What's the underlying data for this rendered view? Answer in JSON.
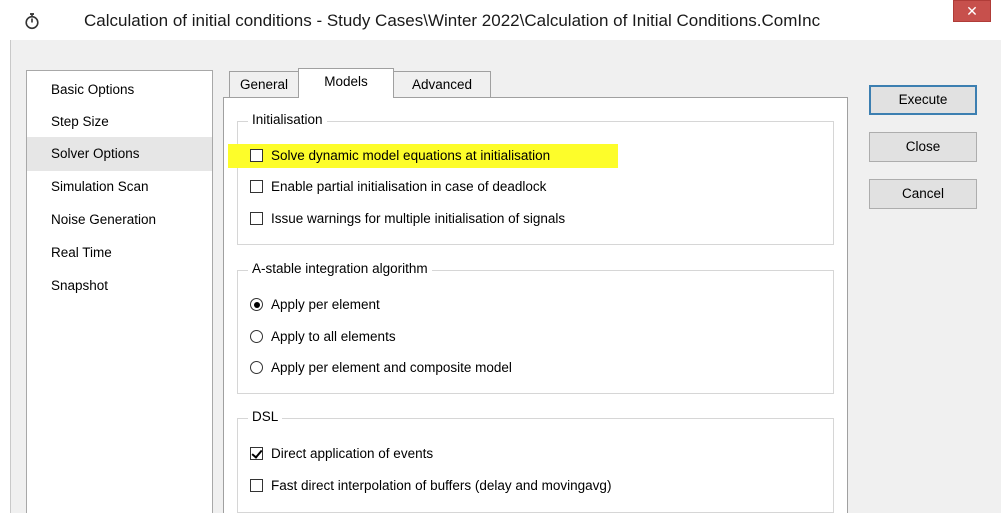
{
  "window": {
    "title": "Calculation of initial conditions - Study Cases\\Winter 2022\\Calculation of Initial Conditions.ComInc",
    "close_glyph": "✕"
  },
  "sidebar": {
    "items": [
      {
        "label": "Basic Options"
      },
      {
        "label": "Step Size"
      },
      {
        "label": "Solver Options",
        "selected": true
      },
      {
        "label": "Simulation Scan"
      },
      {
        "label": "Noise Generation"
      },
      {
        "label": "Real Time"
      },
      {
        "label": "Snapshot"
      }
    ]
  },
  "tabs": [
    {
      "label": "General"
    },
    {
      "label": "Models",
      "active": true
    },
    {
      "label": "Advanced"
    }
  ],
  "initialisation": {
    "title": "Initialisation",
    "options": [
      {
        "label": "Solve dynamic model equations at initialisation",
        "checked": false,
        "highlighted": true
      },
      {
        "label": "Enable partial initialisation in case of deadlock",
        "checked": false
      },
      {
        "label": "Issue warnings for multiple initialisation of signals",
        "checked": false
      }
    ]
  },
  "astable": {
    "title": "A-stable integration algorithm",
    "options": [
      {
        "label": "Apply per element",
        "selected": true
      },
      {
        "label": "Apply to all elements",
        "selected": false
      },
      {
        "label": "Apply per element and composite model",
        "selected": false
      }
    ]
  },
  "dsl": {
    "title": "DSL",
    "options": [
      {
        "label": "Direct application of events",
        "checked": true
      },
      {
        "label": "Fast direct interpolation of buffers (delay and movingavg)",
        "checked": false
      }
    ]
  },
  "buttons": {
    "execute": "Execute",
    "close": "Close",
    "cancel": "Cancel"
  },
  "colors": {
    "highlight": "#fdfd2a",
    "close_button": "#c7504c",
    "default_button_border": "#3c7fb1"
  }
}
